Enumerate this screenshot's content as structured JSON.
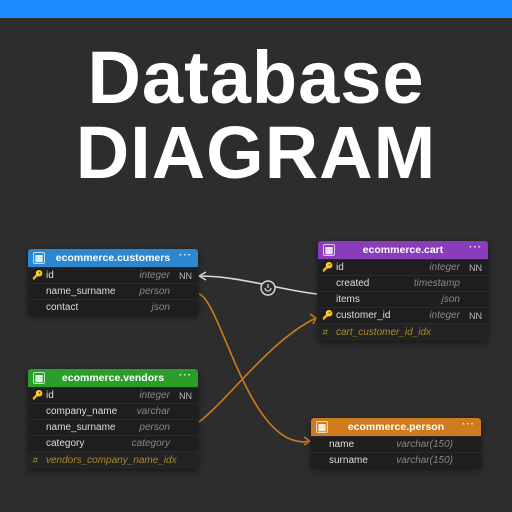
{
  "title": {
    "line1": "Database",
    "line2": "DIAGRAM"
  },
  "tables": {
    "customers": {
      "header": "ecommerce.customers",
      "columns": [
        {
          "key": "pk",
          "name": "id",
          "type": "integer",
          "nn": "NN"
        },
        {
          "key": "",
          "name": "name_surname",
          "type": "person",
          "nn": ""
        },
        {
          "key": "",
          "name": "contact",
          "type": "json",
          "nn": ""
        }
      ]
    },
    "cart": {
      "header": "ecommerce.cart",
      "columns": [
        {
          "key": "pk",
          "name": "id",
          "type": "integer",
          "nn": "NN"
        },
        {
          "key": "",
          "name": "created",
          "type": "timestamp",
          "nn": ""
        },
        {
          "key": "",
          "name": "items",
          "type": "json",
          "nn": ""
        },
        {
          "key": "fk",
          "name": "customer_id",
          "type": "integer",
          "nn": "NN"
        }
      ],
      "index": "cart_customer_id_idx"
    },
    "vendors": {
      "header": "ecommerce.vendors",
      "columns": [
        {
          "key": "pk",
          "name": "id",
          "type": "integer",
          "nn": "NN"
        },
        {
          "key": "",
          "name": "company_name",
          "type": "varchar",
          "nn": ""
        },
        {
          "key": "",
          "name": "name_surname",
          "type": "person",
          "nn": ""
        },
        {
          "key": "",
          "name": "category",
          "type": "category",
          "nn": ""
        }
      ],
      "index": "vendors_company_name_idx"
    },
    "person": {
      "header": "ecommerce.person",
      "columns": [
        {
          "key": "",
          "name": "name",
          "type": "varchar(150)",
          "nn": ""
        },
        {
          "key": "",
          "name": "surname",
          "type": "varchar(150)",
          "nn": ""
        }
      ]
    }
  },
  "icons": {
    "dots": "···",
    "tablehead": "▦",
    "pk": "🔑",
    "fk": "🔑",
    "idx": "⌗"
  }
}
